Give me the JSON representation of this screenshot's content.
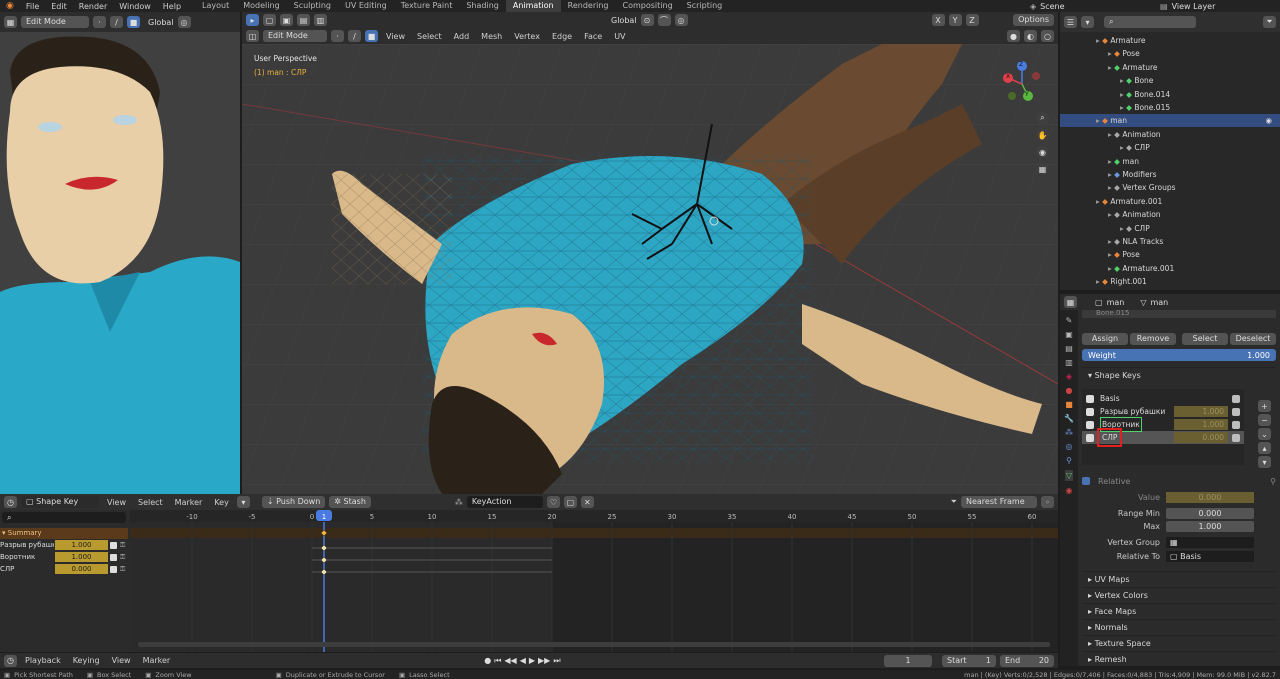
{
  "topbar": {
    "menus": [
      "File",
      "Edit",
      "Render",
      "Window",
      "Help"
    ],
    "workspace_tabs": [
      {
        "label": "Layout",
        "active": false
      },
      {
        "label": "Modeling",
        "active": false
      },
      {
        "label": "Sculpting",
        "active": false
      },
      {
        "label": "UV Editing",
        "active": false
      },
      {
        "label": "Texture Paint",
        "active": false
      },
      {
        "label": "Shading",
        "active": false
      },
      {
        "label": "Animation",
        "active": true
      },
      {
        "label": "Rendering",
        "active": false
      },
      {
        "label": "Compositing",
        "active": false
      },
      {
        "label": "Scripting",
        "active": false
      }
    ],
    "scene": "Scene",
    "view_layer": "View Layer"
  },
  "left_view": {
    "mode": "Edit Mode",
    "orientation": "Global"
  },
  "viewport": {
    "mode": "Edit Mode",
    "orientation": "Global",
    "menus": [
      "View",
      "Select",
      "Add",
      "Mesh",
      "Vertex",
      "Edge",
      "Face",
      "UV"
    ],
    "overlay_title": "User Perspective",
    "overlay_sub": "(1) man : СЛР",
    "options": "Options",
    "gizmo": {
      "x": "X",
      "y": "Y",
      "z": "Z"
    }
  },
  "outliner": {
    "rows": [
      {
        "label": "Armature",
        "indent": 0,
        "icon": "orange"
      },
      {
        "label": "Pose",
        "indent": 1,
        "icon": "orange"
      },
      {
        "label": "Armature",
        "indent": 1,
        "icon": "green"
      },
      {
        "label": "Bone",
        "indent": 2,
        "icon": "green"
      },
      {
        "label": "Bone.014",
        "indent": 2,
        "icon": "green"
      },
      {
        "label": "Bone.015",
        "indent": 2,
        "icon": "green"
      },
      {
        "label": "man",
        "indent": 0,
        "icon": "orange",
        "selected": true
      },
      {
        "label": "Animation",
        "indent": 1,
        "icon": "gray"
      },
      {
        "label": "СЛР",
        "indent": 2,
        "icon": "gray"
      },
      {
        "label": "man",
        "indent": 1,
        "icon": "green"
      },
      {
        "label": "Modifiers",
        "indent": 1,
        "icon": "blue"
      },
      {
        "label": "Vertex Groups",
        "indent": 1,
        "icon": "gray"
      },
      {
        "label": "Armature.001",
        "indent": 0,
        "icon": "orange"
      },
      {
        "label": "Animation",
        "indent": 1,
        "icon": "gray"
      },
      {
        "label": "СЛР",
        "indent": 2,
        "icon": "gray"
      },
      {
        "label": "NLA Tracks",
        "indent": 1,
        "icon": "gray"
      },
      {
        "label": "Pose",
        "indent": 1,
        "icon": "orange"
      },
      {
        "label": "Armature.001",
        "indent": 1,
        "icon": "green"
      },
      {
        "label": "Right.001",
        "indent": 0,
        "icon": "orange"
      }
    ]
  },
  "properties": {
    "object_name": "man",
    "mesh_name": "man",
    "clipped_label": "Bone.015",
    "buttons": {
      "assign": "Assign",
      "remove": "Remove",
      "select": "Select",
      "deselect": "Deselect"
    },
    "weight_label": "Weight",
    "weight_value": "1.000",
    "shape_keys_title": "Shape Keys",
    "shape_keys": [
      {
        "name": "Basis",
        "value": ""
      },
      {
        "name": "Разрыв рубашки",
        "value": "1.000"
      },
      {
        "name": "Воротник",
        "value": "1.000"
      },
      {
        "name": "СЛР",
        "value": "0.000"
      }
    ],
    "relative_label": "Relative",
    "value_label": "Value",
    "value": "0.000",
    "range_min_label": "Range Min",
    "range_min": "0.000",
    "max_label": "Max",
    "max": "1.000",
    "vertex_group_label": "Vertex Group",
    "relative_to_label": "Relative To",
    "relative_to": "Basis",
    "collapsed_panels": [
      "UV Maps",
      "Vertex Colors",
      "Face Maps",
      "Normals",
      "Texture Space",
      "Remesh"
    ]
  },
  "dopesheet": {
    "editor": "Shape Key Editor",
    "menus": [
      "View",
      "Select",
      "Marker",
      "Key"
    ],
    "push_down": "Push Down",
    "stash": "Stash",
    "action": "KeyAction",
    "snap": "Nearest Frame",
    "ticks": [
      "-10",
      "-5",
      "0",
      "1",
      "5",
      "10",
      "15",
      "20",
      "25",
      "30",
      "35",
      "40",
      "45",
      "50",
      "55",
      "60"
    ],
    "summary": "Summary",
    "channels": [
      {
        "name": "Разрыв рубашки",
        "value": "1.000"
      },
      {
        "name": "Воротник",
        "value": "1.000"
      },
      {
        "name": "СЛР",
        "value": "0.000"
      }
    ]
  },
  "playback": {
    "menus": [
      "Playback",
      "Keying",
      "View",
      "Marker"
    ],
    "current_frame": "1",
    "start_label": "Start",
    "start": "1",
    "end_label": "End",
    "end": "20"
  },
  "statusbar": {
    "items": [
      "Pick Shortest Path",
      "Box Select",
      "Zoom View",
      "Duplicate or Extrude to Cursor",
      "Lasso Select"
    ],
    "stats": "man | (Key) Verts:0/2,528 | Edges:0/7,406 | Faces:0/4,883 | Tris:4,909 | Mem: 99.0 MiB | v2.82.7"
  }
}
